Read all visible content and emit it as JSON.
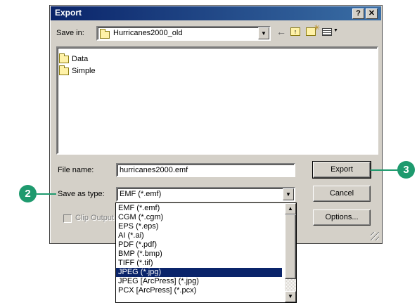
{
  "dialog": {
    "title": "Export",
    "help_label": "?",
    "close_label": "✕"
  },
  "save_in": {
    "label": "Save in:",
    "value": "Hurricanes2000_old"
  },
  "files": [
    {
      "name": "Data"
    },
    {
      "name": "Simple"
    }
  ],
  "file_name": {
    "label": "File name:",
    "value": "hurricanes2000.emf"
  },
  "save_as_type": {
    "label": "Save as type:",
    "value": "EMF (*.emf)"
  },
  "type_options": [
    "EMF (*.emf)",
    "CGM (*.cgm)",
    "EPS (*.eps)",
    "AI (*.ai)",
    "PDF (*.pdf)",
    "BMP (*.bmp)",
    "TIFF (*.tif)",
    "JPEG (*.jpg)",
    "JPEG [ArcPress] (*.jpg)",
    "PCX [ArcPress] (*.pcx)"
  ],
  "selected_option_index": 7,
  "clip_output": {
    "label": "Clip Output"
  },
  "buttons": {
    "export": "Export",
    "cancel": "Cancel",
    "options": "Options..."
  },
  "callouts": {
    "left": "2",
    "right": "3"
  },
  "colors": {
    "callout": "#1e9a6e",
    "titlebar": "#0a246a",
    "selection": "#0a246a"
  }
}
